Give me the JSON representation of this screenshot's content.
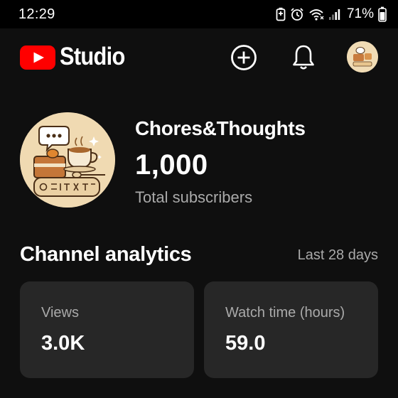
{
  "status_bar": {
    "time": "12:29",
    "battery_percent": "71%",
    "icons": [
      "battery-saver-icon",
      "alarm-icon",
      "wifi-icon",
      "signal-icon",
      "battery-icon"
    ]
  },
  "header": {
    "logo_text": "Studio",
    "logo_color": "#ff0000",
    "icons": [
      "youtube-logo-icon",
      "add-circle-icon",
      "bell-icon",
      "avatar"
    ]
  },
  "channel": {
    "name": "Chores&Thoughts",
    "subscribers": "1,000",
    "subscribers_label": "Total subscribers"
  },
  "analytics": {
    "title": "Channel analytics",
    "period": "Last 28 days",
    "cards": [
      {
        "label": "Views",
        "value": "3.0K"
      },
      {
        "label": "Watch time (hours)",
        "value": "59.0"
      }
    ]
  },
  "colors": {
    "background": "#0f0f0f",
    "card": "#272727",
    "text_primary": "#ffffff",
    "text_secondary": "#aaaaaa",
    "brand_red": "#ff0000"
  }
}
